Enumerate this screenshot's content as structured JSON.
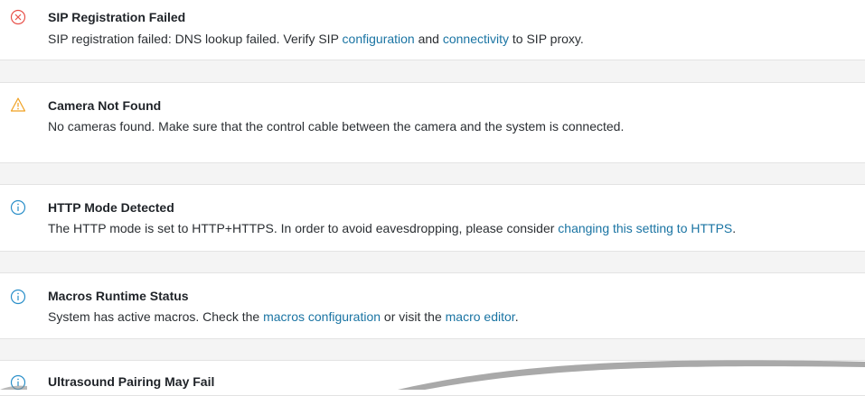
{
  "alerts": [
    {
      "severity": "error",
      "icon": "error-x-icon",
      "title": "SIP Registration Failed",
      "msg_parts": [
        "SIP registration failed: DNS lookup failed. Verify SIP ",
        "configuration",
        " and ",
        "connectivity",
        " to SIP proxy."
      ]
    },
    {
      "severity": "warning",
      "icon": "warning-triangle-icon",
      "title": "Camera Not Found",
      "msg_parts": [
        "No cameras found. Make sure that the control cable between the camera and the system is connected."
      ]
    },
    {
      "severity": "info",
      "icon": "info-icon",
      "title": "HTTP Mode Detected",
      "msg_parts": [
        "The HTTP mode is set to HTTP+HTTPS. In order to avoid eavesdropping, please consider ",
        "changing this setting to HTTPS",
        "."
      ]
    },
    {
      "severity": "info",
      "icon": "info-icon",
      "title": "Macros Runtime Status",
      "msg_parts": [
        "System has active macros. Check the ",
        "macros configuration",
        " or visit the ",
        "macro editor",
        "."
      ]
    },
    {
      "severity": "info",
      "icon": "info-icon",
      "title": "Ultrasound Pairing May Fail"
    }
  ],
  "colors": {
    "error": "#e8514a",
    "warning": "#f0a020",
    "info": "#2a8fc9",
    "link": "#1a74a3",
    "background": "#f4f4f4"
  }
}
